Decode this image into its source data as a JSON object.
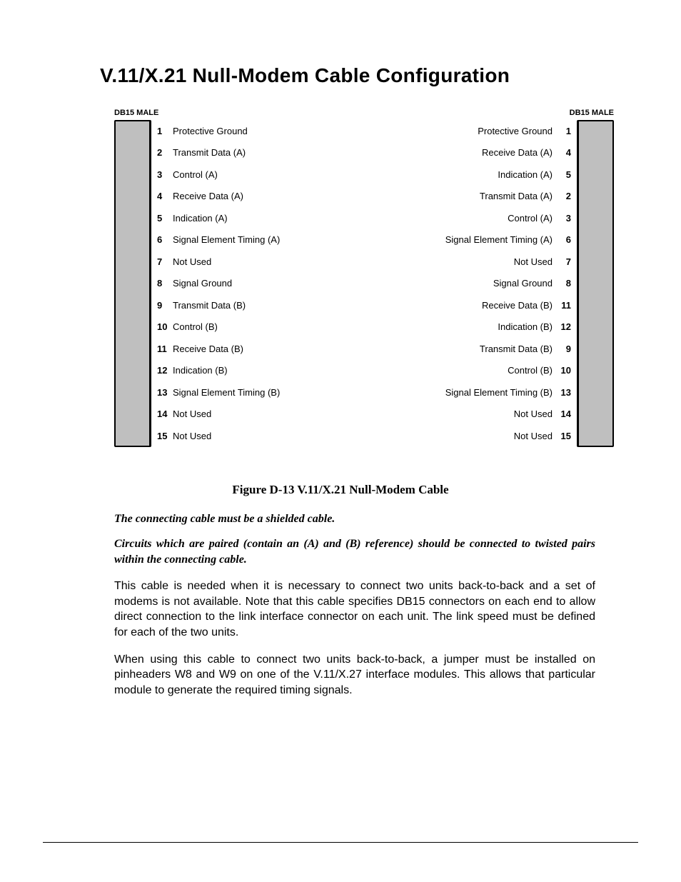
{
  "title": "V.11/X.21 Null-Modem Cable Configuration",
  "diagram": {
    "left_header": "DB15 MALE",
    "right_header": "DB15 MALE",
    "rows": [
      {
        "lpin": "1",
        "llabel": "Protective Ground",
        "rlabel": "Protective Ground",
        "rpin": "1"
      },
      {
        "lpin": "2",
        "llabel": "Transmit Data (A)",
        "rlabel": "Receive Data (A)",
        "rpin": "4"
      },
      {
        "lpin": "3",
        "llabel": "Control (A)",
        "rlabel": "Indication (A)",
        "rpin": "5"
      },
      {
        "lpin": "4",
        "llabel": "Receive Data (A)",
        "rlabel": "Transmit Data (A)",
        "rpin": "2"
      },
      {
        "lpin": "5",
        "llabel": "Indication (A)",
        "rlabel": "Control (A)",
        "rpin": "3"
      },
      {
        "lpin": "6",
        "llabel": "Signal Element Timing (A)",
        "rlabel": "Signal Element Timing (A)",
        "rpin": "6"
      },
      {
        "lpin": "7",
        "llabel": "Not Used",
        "rlabel": "Not Used",
        "rpin": "7"
      },
      {
        "lpin": "8",
        "llabel": "Signal Ground",
        "rlabel": "Signal Ground",
        "rpin": "8"
      },
      {
        "lpin": "9",
        "llabel": "Transmit Data (B)",
        "rlabel": "Receive Data (B)",
        "rpin": "11"
      },
      {
        "lpin": "10",
        "llabel": "Control (B)",
        "rlabel": "Indication (B)",
        "rpin": "12"
      },
      {
        "lpin": "11",
        "llabel": "Receive Data (B)",
        "rlabel": "Transmit Data (B)",
        "rpin": "9"
      },
      {
        "lpin": "12",
        "llabel": "Indication (B)",
        "rlabel": "Control (B)",
        "rpin": "10"
      },
      {
        "lpin": "13",
        "llabel": "Signal Element Timing (B)",
        "rlabel": "Signal Element Timing (B)",
        "rpin": "13"
      },
      {
        "lpin": "14",
        "llabel": "Not Used",
        "rlabel": "Not Used",
        "rpin": "14"
      },
      {
        "lpin": "15",
        "llabel": "Not Used",
        "rlabel": "Not Used",
        "rpin": "15"
      }
    ]
  },
  "caption": "Figure D-13  V.11/X.21 Null-Modem Cable",
  "notes": {
    "n1": "The connecting cable must be a shielded cable.",
    "n2": "Circuits which are paired (contain an (A) and (B) reference) should be connected to twisted pairs within the connecting cable."
  },
  "paragraphs": {
    "p1": "This cable is needed when it is necessary to connect two units back-to-back and a set of modems is not available.  Note that this cable specifies DB15 connectors on each end to allow direct connection to the link interface connector on each unit.  The link speed must be defined for each of the two units.",
    "p2": "When using this cable to connect two units back-to-back, a jumper must be installed on pinheaders W8 and W9 on one of the V.11/X.27 interface modules.  This allows that particular module to generate the required timing signals."
  }
}
